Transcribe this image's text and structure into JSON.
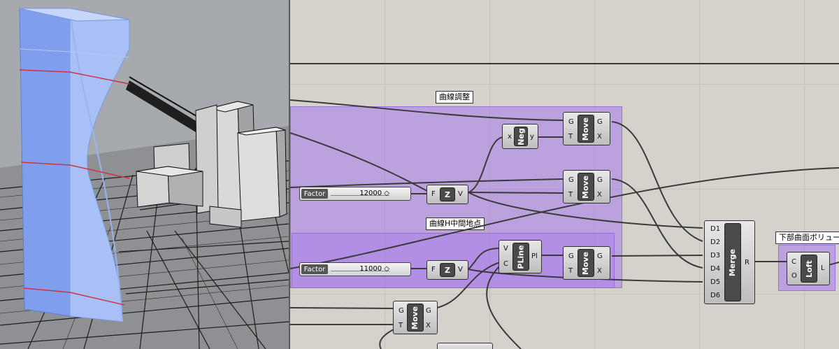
{
  "canvas": {
    "groups": [
      {
        "label": "曲線調整"
      },
      {
        "label": "曲線H中間地点"
      },
      {
        "label": "下部曲面ボリューム"
      }
    ],
    "sliders": [
      {
        "name": "Factor",
        "value": "12000 ◇"
      },
      {
        "name": "Factor",
        "value": "11000 ◇"
      }
    ],
    "components": {
      "neg": {
        "title": "Neg",
        "in": [
          "x"
        ],
        "out": [
          "y"
        ]
      },
      "move1": {
        "title": "Move",
        "in": [
          "G",
          "T"
        ],
        "out": [
          "G",
          "X"
        ]
      },
      "move2": {
        "title": "Move",
        "in": [
          "G",
          "T"
        ],
        "out": [
          "G",
          "X"
        ]
      },
      "move3": {
        "title": "Move",
        "in": [
          "G",
          "T"
        ],
        "out": [
          "G",
          "X"
        ]
      },
      "move4": {
        "title": "Move",
        "in": [
          "G",
          "T"
        ],
        "out": [
          "G",
          "X"
        ]
      },
      "z1": {
        "title": "Z",
        "in": [
          "F"
        ],
        "out": [
          "V"
        ]
      },
      "z2": {
        "title": "Z",
        "in": [
          "F"
        ],
        "out": [
          "V"
        ]
      },
      "pline": {
        "title": "PLine",
        "in": [
          "V",
          "C"
        ],
        "out": [
          "Pl"
        ]
      },
      "merge": {
        "title": "Merge",
        "in": [
          "D1",
          "D2",
          "D3",
          "D4",
          "D5",
          "D6"
        ],
        "out": [
          "R"
        ]
      },
      "loft": {
        "title": "Loft",
        "in": [
          "C",
          "O"
        ],
        "out": [
          "L"
        ]
      }
    }
  },
  "colors": {
    "group_fill": "#a878f0",
    "tower_blue": "#8fb0f5",
    "wire": "#333333"
  }
}
